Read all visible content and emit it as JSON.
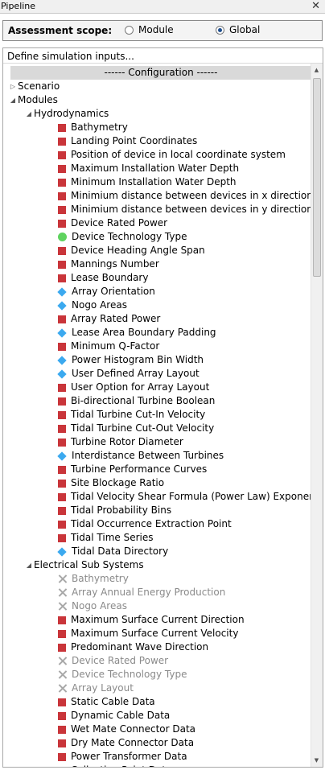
{
  "titlebar": {
    "title": "Pipeline",
    "close": "✕"
  },
  "scope": {
    "label": "Assessment scope:",
    "options": [
      {
        "label": "Module",
        "checked": false
      },
      {
        "label": "Global",
        "checked": true
      }
    ]
  },
  "inputs_header": "Define simulation inputs...",
  "config_bar": "------   Configuration   ------",
  "tree": {
    "scenario": {
      "label": "Scenario",
      "expanded": false
    },
    "modules": {
      "label": "Modules",
      "expanded": true,
      "hydrodynamics": {
        "label": "Hydrodynamics",
        "items": [
          {
            "label": "Bathymetry",
            "status": "red"
          },
          {
            "label": "Landing Point Coordinates",
            "status": "red"
          },
          {
            "label": "Position of device in local coordinate system",
            "status": "red"
          },
          {
            "label": "Maximum Installation Water Depth",
            "status": "red"
          },
          {
            "label": "Minimum Installation Water Depth",
            "status": "red"
          },
          {
            "label": "Minimium distance between devices in x direction",
            "status": "red"
          },
          {
            "label": "Minimium distance between devices in y direction",
            "status": "red"
          },
          {
            "label": "Device Rated Power",
            "status": "red"
          },
          {
            "label": "Device Technology Type",
            "status": "green"
          },
          {
            "label": "Device Heading Angle Span",
            "status": "red"
          },
          {
            "label": "Mannings Number",
            "status": "red"
          },
          {
            "label": "Lease Boundary",
            "status": "red"
          },
          {
            "label": "Array Orientation",
            "status": "blue"
          },
          {
            "label": "Nogo Areas",
            "status": "blue"
          },
          {
            "label": "Array Rated Power",
            "status": "red"
          },
          {
            "label": "Lease Area Boundary Padding",
            "status": "blue"
          },
          {
            "label": "Minimum Q-Factor",
            "status": "red"
          },
          {
            "label": "Power Histogram Bin Width",
            "status": "blue"
          },
          {
            "label": "User Defined Array Layout",
            "status": "blue"
          },
          {
            "label": "User Option for Array Layout",
            "status": "red"
          },
          {
            "label": "Bi-directional Turbine Boolean",
            "status": "red"
          },
          {
            "label": "Tidal Turbine Cut-In Velocity",
            "status": "red"
          },
          {
            "label": "Tidal Turbine Cut-Out Velocity",
            "status": "red"
          },
          {
            "label": "Turbine Rotor Diameter",
            "status": "red"
          },
          {
            "label": "Interdistance Between Turbines",
            "status": "blue"
          },
          {
            "label": "Turbine Performance Curves",
            "status": "red"
          },
          {
            "label": "Site Blockage Ratio",
            "status": "red"
          },
          {
            "label": "Tidal Velocity Shear Formula (Power Law) Exponent",
            "status": "red"
          },
          {
            "label": "Tidal Probability Bins",
            "status": "red"
          },
          {
            "label": "Tidal Occurrence Extraction Point",
            "status": "red"
          },
          {
            "label": "Tidal Time Series",
            "status": "red"
          },
          {
            "label": "Tidal Data Directory",
            "status": "blue"
          }
        ]
      },
      "electrical": {
        "label": "Electrical Sub Systems",
        "items": [
          {
            "label": "Bathymetry",
            "status": "gray"
          },
          {
            "label": "Array Annual Energy Production",
            "status": "gray"
          },
          {
            "label": "Nogo Areas",
            "status": "gray"
          },
          {
            "label": "Maximum Surface Current Direction",
            "status": "red"
          },
          {
            "label": "Maximum Surface Current Velocity",
            "status": "red"
          },
          {
            "label": "Predominant Wave Direction",
            "status": "red"
          },
          {
            "label": "Device Rated Power",
            "status": "gray"
          },
          {
            "label": "Device Technology Type",
            "status": "gray"
          },
          {
            "label": "Array Layout",
            "status": "gray"
          },
          {
            "label": "Static Cable Data",
            "status": "red"
          },
          {
            "label": "Dynamic Cable Data",
            "status": "red"
          },
          {
            "label": "Wet Mate Connector Data",
            "status": "red"
          },
          {
            "label": "Dry Mate Connector Data",
            "status": "red"
          },
          {
            "label": "Power Transformer Data",
            "status": "red"
          },
          {
            "label": "Collection Point Data",
            "status": "red"
          }
        ]
      }
    }
  },
  "colors": {
    "red": "#c9353a",
    "green": "#5fd35f",
    "blue": "#3ba9ef",
    "gray": "#a8a8a8"
  }
}
